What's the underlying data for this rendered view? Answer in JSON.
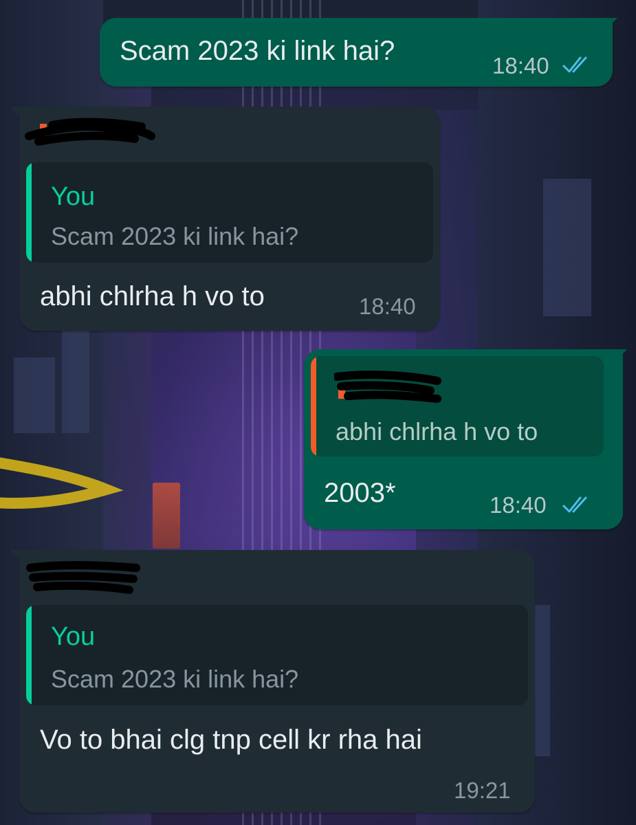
{
  "colors": {
    "outgoing_bubble": "#005c4b",
    "incoming_bubble": "#1f2c34",
    "quote_accent_you": "#06cf9c",
    "quote_accent_other": "#f15c2a",
    "read_ticks": "#53bdeb"
  },
  "messages": [
    {
      "direction": "outgoing",
      "text": "Scam 2023 ki link hai?",
      "time": "18:40",
      "status_icon": "double-check-read-icon"
    },
    {
      "direction": "incoming",
      "sender": "[redacted]",
      "quote": {
        "author": "You",
        "text": "Scam 2023 ki link hai?"
      },
      "text": "abhi chlrha h vo to",
      "time": "18:40"
    },
    {
      "direction": "outgoing",
      "quote": {
        "author": "[redacted]",
        "text": "abhi chlrha h vo to"
      },
      "text": "2003*",
      "time": "18:40",
      "status_icon": "double-check-read-icon"
    },
    {
      "direction": "incoming",
      "sender": "[redacted]",
      "quote": {
        "author": "You",
        "text": "Scam 2023 ki link hai?"
      },
      "text": "Vo to bhai clg tnp cell kr rha hai",
      "time": "19:21"
    }
  ]
}
